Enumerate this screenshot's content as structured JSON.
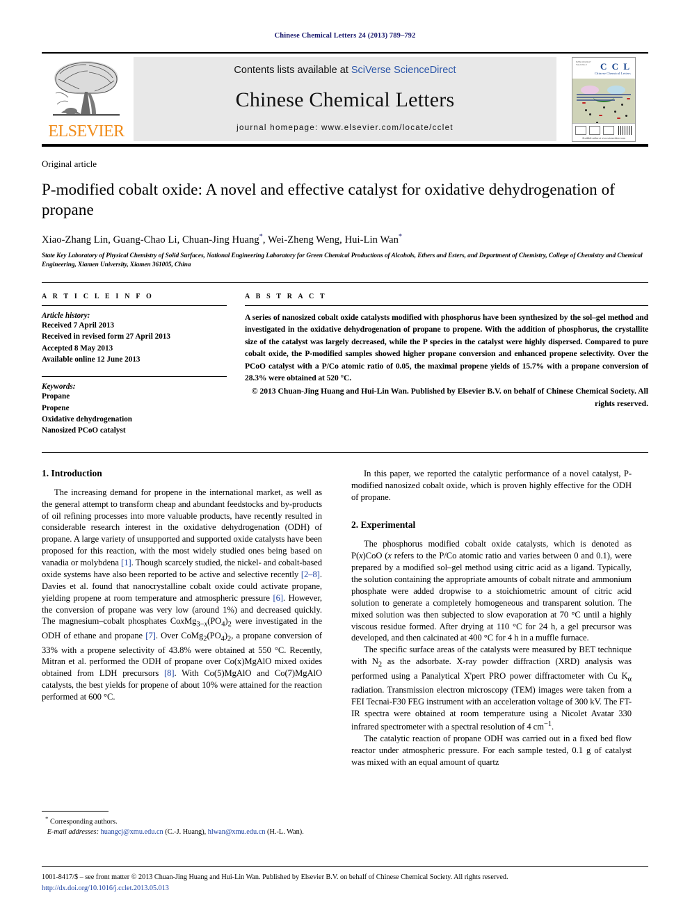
{
  "running_head": "Chinese Chemical Letters 24 (2013) 789–792",
  "masthead": {
    "publisher_logo_label": "ELSEVIER",
    "contents_prefix": "Contents lists available at",
    "contents_link": "SciVerse ScienceDirect",
    "journal_name": "Chinese Chemical Letters",
    "homepage": "journal homepage: www.elsevier.com/locate/cclet",
    "cover": {
      "title": "C C L",
      "subtitle": "Chinese Chemical Letters",
      "footer_note": "Available online at www.sciencedirect.com"
    }
  },
  "article": {
    "kind": "Original article",
    "title": "P-modified cobalt oxide: A novel and effective catalyst for oxidative dehydrogenation of propane",
    "authors": "Xiao-Zhang Lin, Guang-Chao Li, Chuan-Jing Huang",
    "authors_2": ", Wei-Zheng Weng, Hui-Lin Wan",
    "corresponding_mark": "*",
    "affiliation": "State Key Laboratory of Physical Chemistry of Solid Surfaces, National Engineering Laboratory for Green Chemical Productions of Alcohols, Ethers and Esters, and Department of Chemistry, College of Chemistry and Chemical Engineering, Xiamen University, Xiamen 361005, China"
  },
  "article_info": {
    "heading": "A R T I C L E  I N F O",
    "history_title": "Article history:",
    "history": [
      "Received 7 April 2013",
      "Received in revised form 27 April 2013",
      "Accepted 8 May 2013",
      "Available online 12 June 2013"
    ],
    "keywords_title": "Keywords:",
    "keywords": [
      "Propane",
      "Propene",
      "Oxidative dehydrogenation",
      "Nanosized PCoO catalyst"
    ]
  },
  "abstract": {
    "heading": "A B S T R A C T",
    "text": "A series of nanosized cobalt oxide catalysts modified with phosphorus have been synthesized by the sol–gel method and investigated in the oxidative dehydrogenation of propane to propene. With the addition of phosphorus, the crystallite size of the catalyst was largely decreased, while the P species in the catalyst were highly dispersed. Compared to pure cobalt oxide, the P-modified samples showed higher propane conversion and enhanced propene selectivity. Over the PCoO catalyst with a P/Co atomic ratio of 0.05, the maximal propene yields of 15.7% with a propane conversion of 28.3% were obtained at 520 °C.",
    "copyright": "© 2013 Chuan-Jing Huang and Hui-Lin Wan. Published by Elsevier B.V. on behalf of Chinese Chemical Society. All rights reserved."
  },
  "sections": {
    "introduction_heading": "1. Introduction",
    "intro_p1_a": "The increasing demand for propene in the international market, as well as the general attempt to transform cheap and abundant feedstocks and by-products of oil refining processes into more valuable products, have recently resulted in considerable research interest in the oxidative dehydrogenation (ODH) of propane. A large variety of unsupported and supported oxide catalysts have been proposed for this reaction, with the most widely studied ones being based on vanadia or molybdena ",
    "ref1": "[1]",
    "intro_p1_b": ". Though scarcely studied, the nickel- and cobalt-based oxide systems have also been reported to be active and selective recently ",
    "ref2": "[2–8]",
    "intro_p1_c": ". Davies et al. found that nanocrystalline cobalt oxide could activate propane, yielding propene at room temperature and atmospheric pressure ",
    "ref6": "[6]",
    "intro_p1_d": ". However, the conversion of propane was very low (around 1%) and decreased quickly. The magnesium–cobalt phosphates Co",
    "intro_p1_e": " were investigated in the ODH of ethane and propane ",
    "ref7": "[7]",
    "intro_p1_f": ". Over CoMg",
    "intro_p1_g": ", a propane conversion of 33% with a propene selectivity of 43.8% were obtained at 550 °C. Recently, Mitran et al. performed the ODH of propane over Co(x)MgAlO mixed oxides obtained from LDH precursors ",
    "ref8": "[8]",
    "intro_p1_h": ". With Co(5)MgAlO and Co(7)MgAlO catalysts, the best yields for propene of about 10% were attained for the reaction performed at 600 °C.",
    "right_p1": "In this paper, we reported the catalytic performance of a novel catalyst, P-modified nanosized cobalt oxide, which is proven highly effective for the ODH of propane.",
    "experimental_heading": "2. Experimental",
    "exp_p1_a": "The phosphorus modified cobalt oxide catalysts, which is denoted as P(",
    "exp_p1_b": ")CoO (",
    "exp_p1_c": " refers to the P/Co atomic ratio and varies between 0 and 0.1), were prepared by a modified sol–gel method using citric acid as a ligand. Typically, the solution containing the appropriate amounts of cobalt nitrate and ammonium phosphate were added dropwise to a stoichiometric amount of citric acid solution to generate a completely homogeneous and transparent solution. The mixed solution was then subjected to slow evaporation at 70 °C until a highly viscous residue formed. After drying at 110 °C for 24 h, a gel precursor was developed, and then calcinated at 400 °C for 4 h in a muffle furnace.",
    "exp_p2_a": "The specific surface areas of the catalysts were measured by BET technique with N",
    "exp_p2_b": " as the adsorbate. X-ray powder diffraction (XRD) analysis was performed using a Panalytical X'pert PRO power diffractometer with Cu K",
    "exp_p2_c": " radiation. Transmission electron microscopy (TEM) images were taken from a FEI Tecnai-F30 FEG instrument with an acceleration voltage of 300 kV. The FT-IR spectra were obtained at room temperature using a Nicolet Avatar 330 infrared spectrometer with a spectral resolution of 4 cm",
    "exp_p2_d": ".",
    "exp_p3": "The catalytic reaction of propane ODH was carried out in a fixed bed flow reactor under atmospheric pressure. For each sample tested, 0.1 g of catalyst was mixed with an equal amount of quartz"
  },
  "footnote": {
    "star": "*",
    "corresponding": "Corresponding authors.",
    "email_label": "E-mail addresses:",
    "email1": "huangcj@xmu.edu.cn",
    "email1_who": "(C.-J. Huang),",
    "email2": "hlwan@xmu.edu.cn",
    "email2_who": "(H.-L. Wan)."
  },
  "bottom": {
    "issn_line": "1001-8417/$ – see front matter © 2013 Chuan-Jing Huang and Hui-Lin Wan. Published by Elsevier B.V. on behalf of Chinese Chemical Society. All rights reserved.",
    "doi": "http://dx.doi.org/10.1016/j.cclet.2013.05.013"
  },
  "colors": {
    "link": "#1a3fa0",
    "running_head": "#1a1a6e",
    "elsevier_orange": "#F08C1B",
    "band_gray": "#e8e8e8"
  }
}
